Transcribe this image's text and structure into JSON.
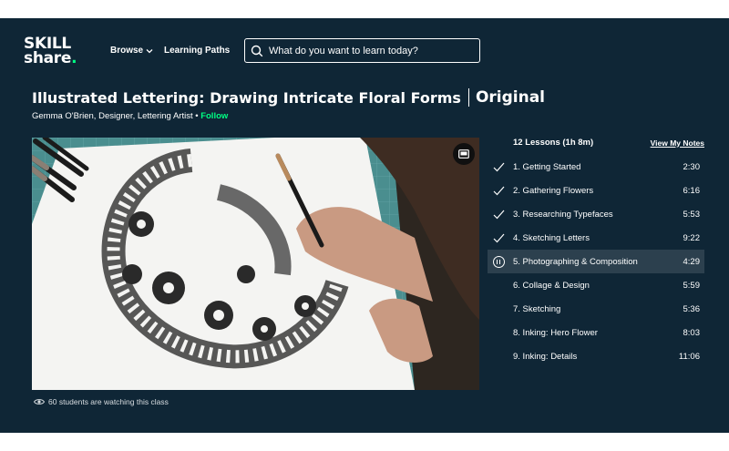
{
  "header": {
    "logo_line1": "SKILL",
    "logo_line2": "share",
    "logo_dot": ".",
    "browse_label": "Browse",
    "learning_paths_label": "Learning Paths",
    "search_placeholder": "What do you want to learn today?"
  },
  "course": {
    "title": "Illustrated Lettering: Drawing Intricate Floral Forms",
    "badge": "Original",
    "author": "Gemma O'Brien, Designer, Lettering Artist",
    "separator": " • ",
    "follow_label": "Follow"
  },
  "video": {
    "watching_text": "60 students are watching this class"
  },
  "lessons": {
    "count_label": "12 Lessons (1h 8m)",
    "notes_label": "View My Notes",
    "items": [
      {
        "label": "1.  Getting Started",
        "duration": "2:30",
        "state": "completed"
      },
      {
        "label": "2.  Gathering Flowers",
        "duration": "6:16",
        "state": "completed"
      },
      {
        "label": "3.  Researching Typefaces",
        "duration": "5:53",
        "state": "completed"
      },
      {
        "label": "4.  Sketching Letters",
        "duration": "9:22",
        "state": "completed"
      },
      {
        "label": "5.  Photographing & Composition",
        "duration": "4:29",
        "state": "playing"
      },
      {
        "label": "6.  Collage & Design",
        "duration": "5:59",
        "state": "none"
      },
      {
        "label": "7.  Sketching",
        "duration": "5:36",
        "state": "none"
      },
      {
        "label": "8.  Inking: Hero Flower",
        "duration": "8:03",
        "state": "none"
      },
      {
        "label": "9.  Inking: Details",
        "duration": "11:06",
        "state": "none"
      }
    ]
  },
  "colors": {
    "background": "#0f2636",
    "accent": "#00ff84",
    "active_row": "#2c404e"
  },
  "icons": {
    "search": "search-icon",
    "browse": "chevron-down-icon",
    "pip": "picture-in-picture-icon",
    "watching": "eye-icon",
    "completed": "check-icon",
    "playing": "pause-icon"
  }
}
